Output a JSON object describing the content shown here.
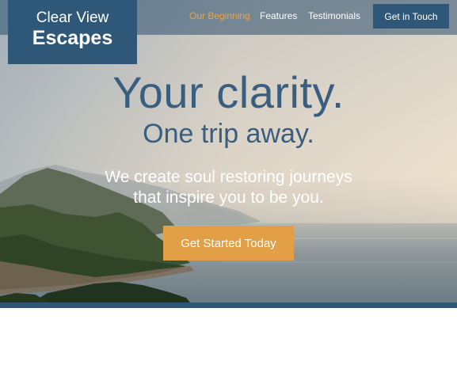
{
  "brand": {
    "line1": "Clear View",
    "line2": "Escapes"
  },
  "nav": {
    "items": [
      {
        "label": "Our Beginning",
        "active": true
      },
      {
        "label": "Features",
        "active": false
      },
      {
        "label": "Testimonials",
        "active": false
      }
    ],
    "cta_label": "Get in Touch"
  },
  "hero": {
    "headline": "Your clarity.",
    "subheadline": "One trip away.",
    "tagline_line1": "We create soul restoring journeys",
    "tagline_line2": "that inspire you to be you.",
    "cta_label": "Get Started Today"
  },
  "colors": {
    "brand_blue": "#2f5878",
    "accent_orange": "#e29f45",
    "active_nav": "#e5a54c",
    "heading_blue": "#3a5e80"
  }
}
